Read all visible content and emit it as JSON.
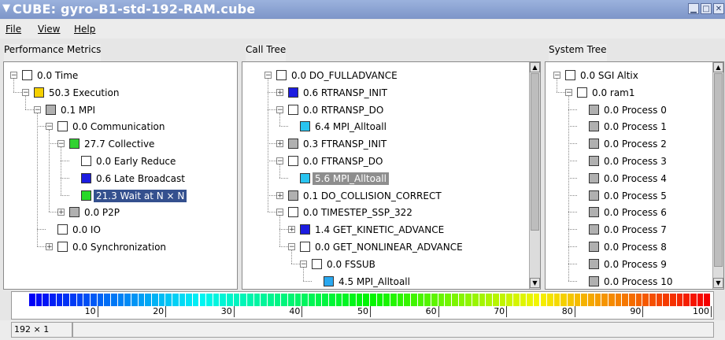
{
  "window": {
    "title": "CUBE: gyro-B1-std-192-RAM.cube",
    "buttons": [
      "minimize",
      "maximize",
      "close"
    ]
  },
  "menu": [
    "File",
    "View",
    "Help"
  ],
  "panels": {
    "metrics": {
      "header": "Performance Metrics"
    },
    "calltree": {
      "header": "Call Tree"
    },
    "system": {
      "header": "System Tree"
    }
  },
  "metrics_rows": [
    {
      "label": "0.0 Time",
      "color": "#ffffff",
      "exp": "minus",
      "depth": 0
    },
    {
      "label": "50.3 Execution",
      "color": "#f5d000",
      "exp": "minus",
      "depth": 1
    },
    {
      "label": "0.1 MPI",
      "color": "#b0b0b0",
      "exp": "minus",
      "depth": 2
    },
    {
      "label": "0.0 Communication",
      "color": "#ffffff",
      "exp": "minus",
      "depth": 3
    },
    {
      "label": "27.7 Collective",
      "color": "#32d232",
      "exp": "minus",
      "depth": 4
    },
    {
      "label": "0.0 Early Reduce",
      "color": "#ffffff",
      "exp": "none",
      "depth": 5
    },
    {
      "label": "0.6 Late Broadcast",
      "color": "#1c1ce0",
      "exp": "none",
      "depth": 5
    },
    {
      "label": "21.3 Wait at N × N",
      "color": "#28d828",
      "exp": "none",
      "depth": 5,
      "selected": true
    },
    {
      "label": "0.0 P2P",
      "color": "#b0b0b0",
      "exp": "plus",
      "depth": 4
    },
    {
      "label": "0.0 IO",
      "color": "#ffffff",
      "exp": "none",
      "depth": 3
    },
    {
      "label": "0.0 Synchronization",
      "color": "#ffffff",
      "exp": "plus",
      "depth": 3
    }
  ],
  "call_rows": [
    {
      "label": "0.0 DO_FULLADVANCE",
      "color": "#ffffff",
      "exp": "minus",
      "depth": 0
    },
    {
      "label": "0.6 RTRANSP_INIT",
      "color": "#1c1ce0",
      "exp": "plus",
      "depth": 1
    },
    {
      "label": "0.0 RTRANSP_DO",
      "color": "#ffffff",
      "exp": "minus",
      "depth": 1
    },
    {
      "label": "6.4 MPI_Alltoall",
      "color": "#29c4f0",
      "exp": "none",
      "depth": 2
    },
    {
      "label": "0.3 FTRANSP_INIT",
      "color": "#b0b0b0",
      "exp": "plus",
      "depth": 1
    },
    {
      "label": "0.0 FTRANSP_DO",
      "color": "#ffffff",
      "exp": "minus",
      "depth": 1
    },
    {
      "label": "5.6 MPI_Alltoall",
      "color": "#29c4f0",
      "exp": "none",
      "depth": 2,
      "current": true
    },
    {
      "label": "0.1 DO_COLLISION_CORRECT",
      "color": "#b0b0b0",
      "exp": "plus",
      "depth": 1
    },
    {
      "label": "0.0 TIMESTEP_SSP_322",
      "color": "#ffffff",
      "exp": "minus",
      "depth": 1
    },
    {
      "label": "1.4 GET_KINETIC_ADVANCE",
      "color": "#1c1ce0",
      "exp": "plus",
      "depth": 2
    },
    {
      "label": "0.0 GET_NONLINEAR_ADVANCE",
      "color": "#ffffff",
      "exp": "minus",
      "depth": 2
    },
    {
      "label": "0.0 FSSUB",
      "color": "#ffffff",
      "exp": "minus",
      "depth": 3
    },
    {
      "label": "4.5 MPI_Alltoall",
      "color": "#29a8f0",
      "exp": "none",
      "depth": 4
    }
  ],
  "system_rows": [
    {
      "label": "0.0 SGI Altix",
      "color": "#ffffff",
      "exp": "minus",
      "depth": 0
    },
    {
      "label": "0.0 ram1",
      "color": "#ffffff",
      "exp": "minus",
      "depth": 1
    },
    {
      "label": "0.0 Process 0",
      "color": "#b0b0b0",
      "exp": "none",
      "depth": 2
    },
    {
      "label": "0.0 Process 1",
      "color": "#b0b0b0",
      "exp": "none",
      "depth": 2
    },
    {
      "label": "0.0 Process 2",
      "color": "#b0b0b0",
      "exp": "none",
      "depth": 2
    },
    {
      "label": "0.0 Process 3",
      "color": "#b0b0b0",
      "exp": "none",
      "depth": 2
    },
    {
      "label": "0.0 Process 4",
      "color": "#b0b0b0",
      "exp": "none",
      "depth": 2
    },
    {
      "label": "0.0 Process 5",
      "color": "#b0b0b0",
      "exp": "none",
      "depth": 2
    },
    {
      "label": "0.0 Process 6",
      "color": "#b0b0b0",
      "exp": "none",
      "depth": 2
    },
    {
      "label": "0.0 Process 7",
      "color": "#b0b0b0",
      "exp": "none",
      "depth": 2
    },
    {
      "label": "0.0 Process 8",
      "color": "#b0b0b0",
      "exp": "none",
      "depth": 2
    },
    {
      "label": "0.0 Process 9",
      "color": "#b0b0b0",
      "exp": "none",
      "depth": 2
    },
    {
      "label": "0.0 Process 10",
      "color": "#b0b0b0",
      "exp": "none",
      "depth": 2
    }
  ],
  "color_scale": {
    "ticks": [
      "10",
      "20",
      "30",
      "40",
      "50",
      "60",
      "70",
      "80",
      "90",
      "100"
    ]
  },
  "status": {
    "dims": "192 × 1",
    "message": ""
  }
}
